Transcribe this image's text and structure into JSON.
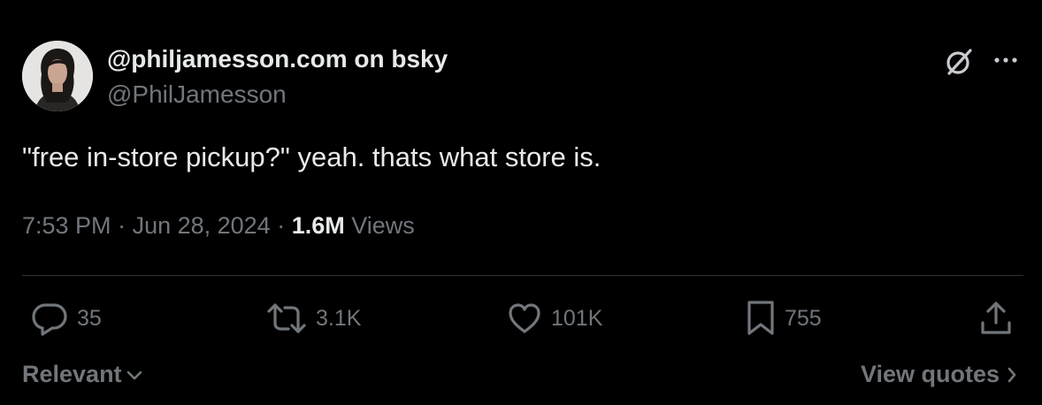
{
  "author": {
    "display_name": "@philjamesson.com on bsky",
    "handle": "@PhilJamesson"
  },
  "tweet": {
    "text": "\"free in-store pickup?\" yeah. thats what store is."
  },
  "meta": {
    "time": "7:53 PM",
    "sep1": " · ",
    "date": "Jun 28, 2024",
    "sep2": " · ",
    "views_count": "1.6M",
    "views_label": " Views"
  },
  "actions": {
    "replies": "35",
    "reposts": "3.1K",
    "likes": "101K",
    "bookmarks": "755"
  },
  "footer": {
    "sort_label": "Relevant",
    "view_quotes_label": "View quotes"
  },
  "icons": {
    "grok": "grok-icon",
    "more": "more-horizontal-icon",
    "reply": "reply-icon",
    "repost": "repost-icon",
    "like": "heart-icon",
    "bookmark": "bookmark-icon",
    "share": "share-icon",
    "sort_chevron": "chevron-down-icon",
    "quotes_chevron": "chevron-right-icon"
  },
  "colors": {
    "background": "#000000",
    "primary_text": "#e7e9ea",
    "secondary_text": "#71767b",
    "divider": "#2f3336"
  }
}
